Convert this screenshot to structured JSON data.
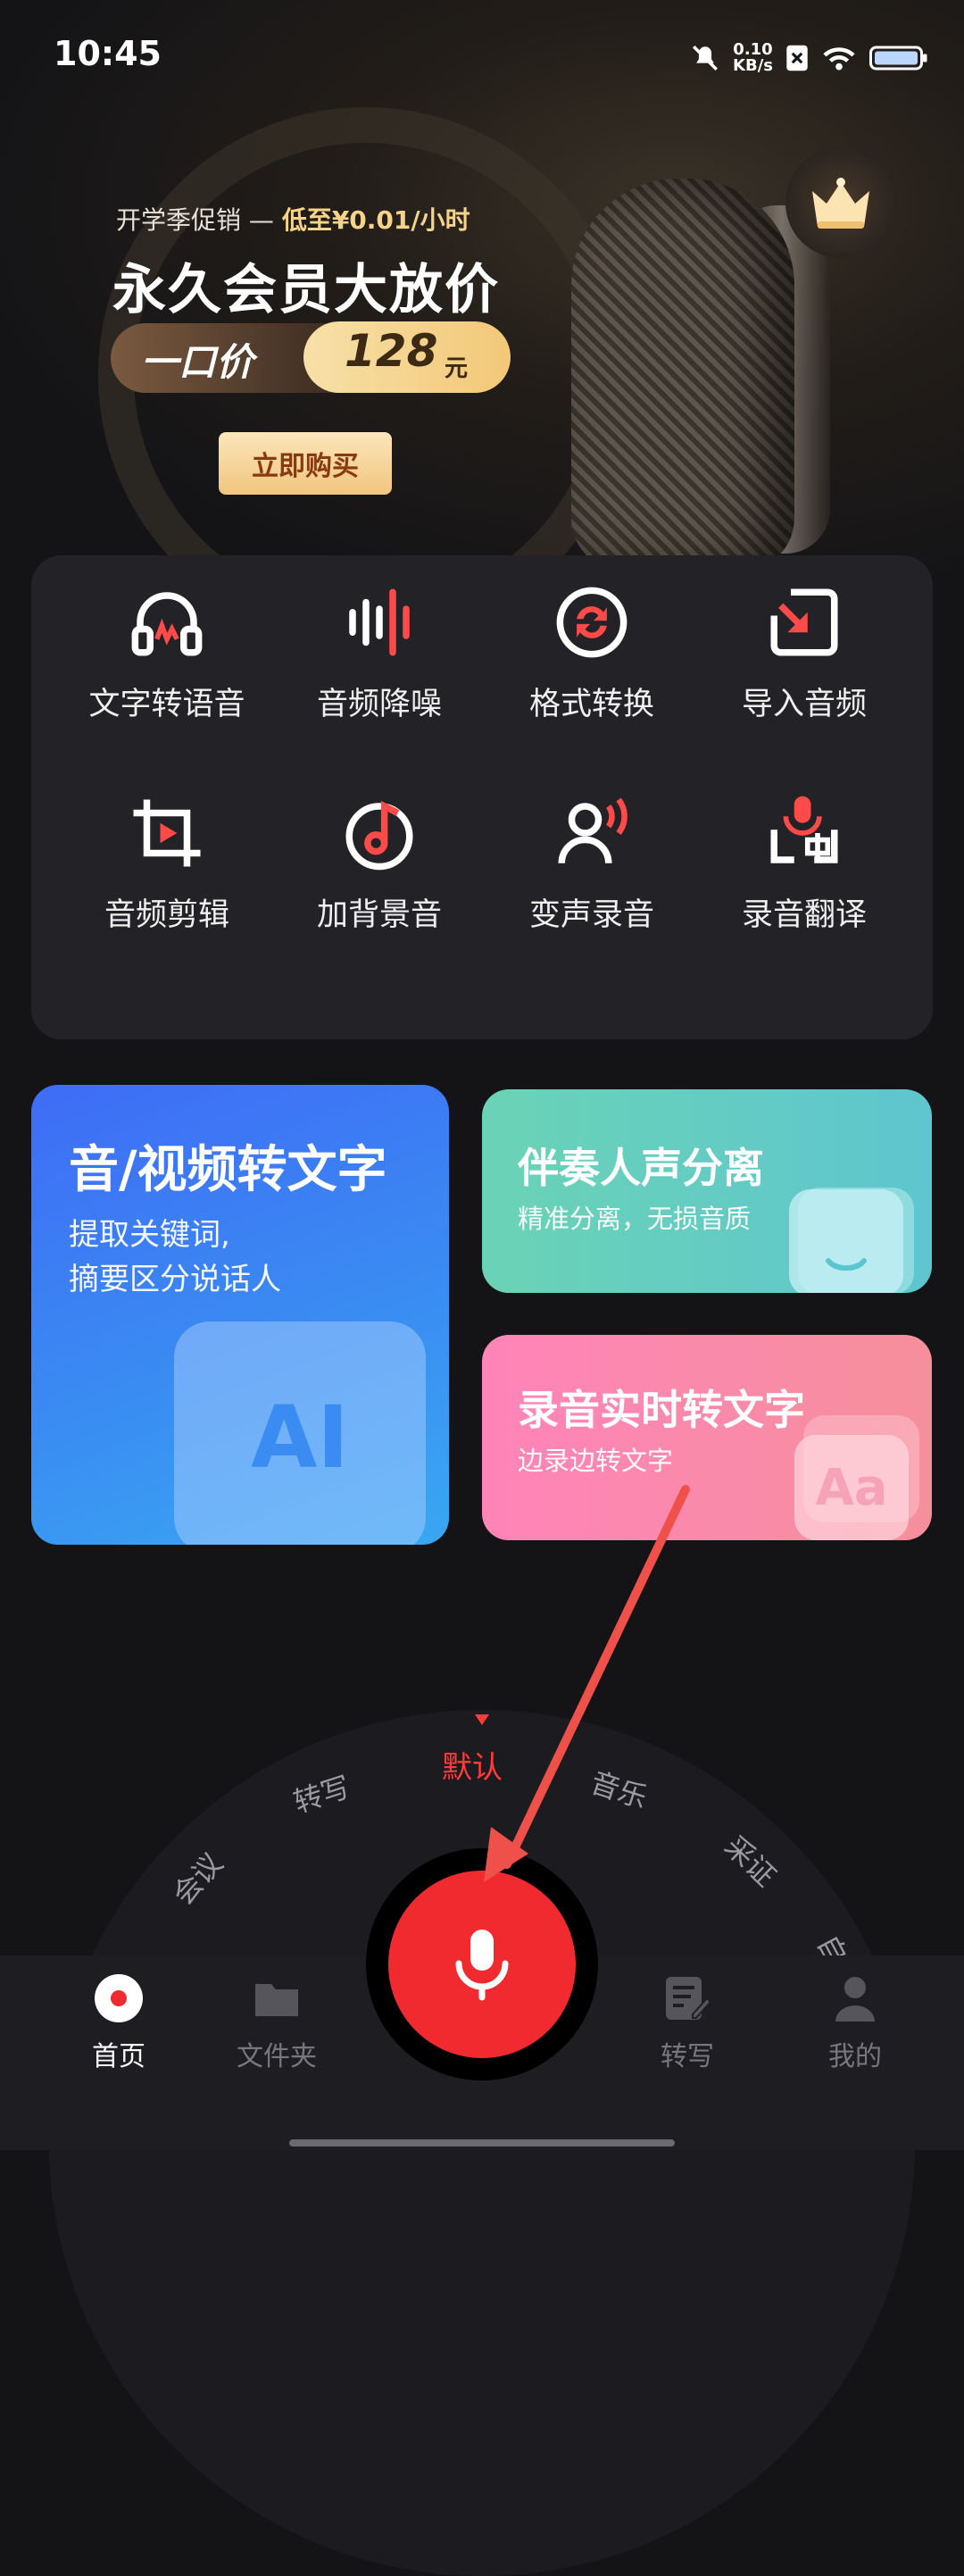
{
  "status_bar": {
    "time": "10:45",
    "net_speed_value": "0.10",
    "net_speed_unit": "KB/s",
    "icons": [
      "mute-icon",
      "sim-off-icon",
      "wifi-icon",
      "battery-icon"
    ]
  },
  "banner": {
    "promo_prefix": "开学季促销 —",
    "promo_highlight": "低至¥0.01/小时",
    "title": "永久会员大放价",
    "price_label": "一口价",
    "price_value": "128",
    "price_unit": "元",
    "buy_label": "立即购买",
    "vip_icon": "crown-icon"
  },
  "tools": [
    {
      "label": "文字转语音",
      "icon": "headphones-icon"
    },
    {
      "label": "音频降噪",
      "icon": "waveform-icon"
    },
    {
      "label": "格式转换",
      "icon": "convert-icon"
    },
    {
      "label": "导入音频",
      "icon": "import-icon"
    },
    {
      "label": "音频剪辑",
      "icon": "crop-icon"
    },
    {
      "label": "加背景音",
      "icon": "music-disc-icon"
    },
    {
      "label": "变声录音",
      "icon": "voice-change-icon"
    },
    {
      "label": "录音翻译",
      "icon": "translate-icon"
    }
  ],
  "cards": {
    "av_to_text": {
      "title": "音/视频转文字",
      "sub1": "提取关键词,",
      "sub2": "摘要区分说话人",
      "badge": "AI"
    },
    "separation": {
      "title": "伴奏人声分离",
      "sub": "精准分离，无损音质"
    },
    "realtime": {
      "title": "录音实时转文字",
      "sub": "边录边转文字",
      "badge": "Aa"
    }
  },
  "modes": {
    "meeting": "会议",
    "transcribe": "转写",
    "default": "默认",
    "music": "音乐",
    "evidence": "采证",
    "custom": "自"
  },
  "bottom_nav": {
    "home": "首页",
    "folder": "文件夹",
    "transcribe": "转写",
    "mine": "我的"
  },
  "colors": {
    "accent_red": "#f12a2f",
    "active_mode": "#ff3b3b"
  }
}
